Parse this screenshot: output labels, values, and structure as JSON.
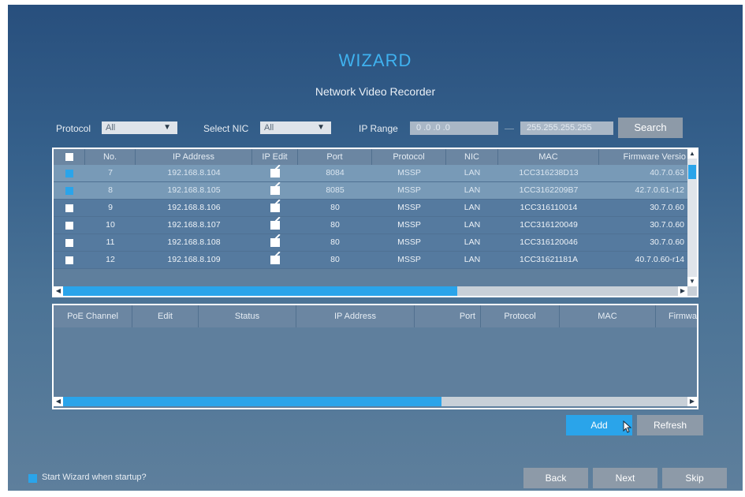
{
  "title": "WIZARD",
  "subtitle": "Network Video Recorder",
  "filters": {
    "protocol_label": "Protocol",
    "protocol_value": "All",
    "nic_label": "Select NIC",
    "nic_value": "All",
    "ip_range_label": "IP Range",
    "ip_start": "0 .0 .0 .0",
    "ip_end": "255.255.255.255",
    "search_label": "Search"
  },
  "device_table": {
    "headers": [
      "No.",
      "IP Address",
      "IP Edit",
      "Port",
      "Protocol",
      "NIC",
      "MAC",
      "Firmware Versio"
    ],
    "rows": [
      {
        "no": "7",
        "ip": "192.168.8.104",
        "port": "8084",
        "protocol": "MSSP",
        "nic": "LAN",
        "mac": "1CC316238D13",
        "firmware": "40.7.0.63",
        "checked": true
      },
      {
        "no": "8",
        "ip": "192.168.8.105",
        "port": "8085",
        "protocol": "MSSP",
        "nic": "LAN",
        "mac": "1CC3162209B7",
        "firmware": "42.7.0.61-r12",
        "checked": true
      },
      {
        "no": "9",
        "ip": "192.168.8.106",
        "port": "80",
        "protocol": "MSSP",
        "nic": "LAN",
        "mac": "1CC316110014",
        "firmware": "30.7.0.60",
        "checked": false
      },
      {
        "no": "10",
        "ip": "192.168.8.107",
        "port": "80",
        "protocol": "MSSP",
        "nic": "LAN",
        "mac": "1CC316120049",
        "firmware": "30.7.0.60",
        "checked": false
      },
      {
        "no": "11",
        "ip": "192.168.8.108",
        "port": "80",
        "protocol": "MSSP",
        "nic": "LAN",
        "mac": "1CC316120046",
        "firmware": "30.7.0.60",
        "checked": false
      },
      {
        "no": "12",
        "ip": "192.168.8.109",
        "port": "80",
        "protocol": "MSSP",
        "nic": "LAN",
        "mac": "1CC31621181A",
        "firmware": "40.7.0.60-r14",
        "checked": false
      }
    ]
  },
  "poe_table": {
    "headers": [
      "PoE Channel",
      "Edit",
      "Status",
      "IP Address",
      "Port",
      "Protocol",
      "MAC",
      "Firmwa"
    ]
  },
  "buttons": {
    "add": "Add",
    "refresh": "Refresh",
    "back": "Back",
    "next": "Next",
    "skip": "Skip"
  },
  "startup_option": "Start Wizard when startup?",
  "colors": {
    "accent": "#2aa4ea",
    "title": "#3fb2f0",
    "button_gray": "#8d9aa8"
  }
}
